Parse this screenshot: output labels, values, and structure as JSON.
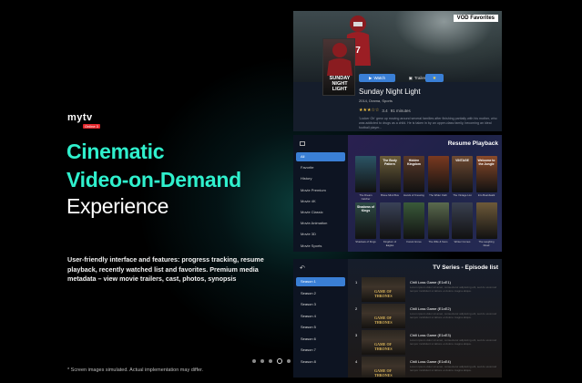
{
  "logo": {
    "word": "mytv",
    "badge": "Online 3"
  },
  "headline": {
    "line1": "Cinematic",
    "line2": "Video-on-Demand",
    "line3": "Experience"
  },
  "description": "User-friendly interface and features: progress tracking, resume playback, recently watched list and favorites. Premium media metadata – view movie trailers, cast, photos, synopsis",
  "disclaimer": "* Screen images simulated. Actual implementation may differ.",
  "pager": {
    "count": 5,
    "active_index": 3
  },
  "vod_panel": {
    "badge": "VOD Favorites",
    "poster_text": "SUNDAY NIGHT LIGHT",
    "watch_label": "Watch",
    "trailer_label": "Trailer",
    "fav_icon": "star-icon",
    "title": "Sunday Night Light",
    "meta": "2014, Drama, Sports",
    "rating": "3.4",
    "duration": "91 minutes",
    "stars": "★★★☆☆",
    "synopsis": "'Locker Oh' grew up moving around several families after finishing partially with his mother, who was addicted to drugs as a child. He is taken in by an upper-class family, becoming an ideal football player..."
  },
  "resume_panel": {
    "title": "Resume Playback",
    "categories": [
      "All",
      "Favorite",
      "History",
      "Movie Premium",
      "Movie 4K",
      "Movie Classic",
      "Movie Animation",
      "Movie 3D",
      "Movie Sports"
    ],
    "selected_category": 0,
    "thumbs_row1": [
      {
        "title": "",
        "caption": "The Dream Catcher",
        "color": "#2c5566"
      },
      {
        "title": "The Body Pattern",
        "caption": "Brave Mind Bus",
        "color": "#6b5d3a"
      },
      {
        "title": "Hidden Kingdom",
        "caption": "Hands of Knowing",
        "color": "#5a3a2a"
      },
      {
        "title": "",
        "caption": "The Wider Oath",
        "color": "#7a3a20"
      },
      {
        "title": "VINTAGE",
        "caption": "The Vintage List",
        "color": "#6e4a32"
      },
      {
        "title": "Welcome to the Jungle",
        "caption": "Into Boardwalk",
        "color": "#8a4a2a"
      }
    ],
    "thumbs_row2": [
      {
        "title": "Shadows of Kings",
        "caption": "Shadows of Kings",
        "color": "#2e4a46"
      },
      {
        "title": "",
        "caption": "Kingdom of Eagles",
        "color": "#3a4258"
      },
      {
        "title": "",
        "caption": "Forest Grove",
        "color": "#3a5a3a"
      },
      {
        "title": "",
        "caption": "The Wife & Sons",
        "color": "#5a6a4e"
      },
      {
        "title": "",
        "caption": "Winter Comes",
        "color": "#3a4050"
      },
      {
        "title": "",
        "caption": "The Laughing Road",
        "color": "#6e5a3a"
      }
    ]
  },
  "series_panel": {
    "title": "TV Series - Episode list",
    "seasons": [
      "Season 1",
      "Season 2",
      "Season 3",
      "Season 4",
      "Season 5",
      "Season 6",
      "Season 7",
      "Season 8"
    ],
    "selected_season": 0,
    "episodes": [
      {
        "num": "1",
        "title": "Chill Loss Game (E1xE1)",
        "desc": "Lorem ipsum dolor sit amet, consectetur adipiscing elit, sed do eiusmod tempor incididunt ut labore et dolore magna aliqua.",
        "art": "GAME OF THRONES"
      },
      {
        "num": "2",
        "title": "Chill Loss Game (E1xE2)",
        "desc": "Lorem ipsum dolor sit amet, consectetur adipiscing elit, sed do eiusmod tempor incididunt ut labore et dolore magna aliqua.",
        "art": "GAME OF THRONES"
      },
      {
        "num": "3",
        "title": "Chill Loss Game (E1xE3)",
        "desc": "Lorem ipsum dolor sit amet, consectetur adipiscing elit, sed do eiusmod tempor incididunt ut labore et dolore magna aliqua.",
        "art": "GAME OF THRONES"
      },
      {
        "num": "4",
        "title": "Chill Loss Game (E1xE4)",
        "desc": "Lorem ipsum dolor sit amet, consectetur adipiscing elit, sed do eiusmod tempor incididunt ut labore et dolore magna aliqua.",
        "art": "GAME OF THRONES"
      }
    ]
  },
  "colors": {
    "accent": "#2ff0cd",
    "button": "#3a7fd5",
    "badge": "#e2262b"
  }
}
